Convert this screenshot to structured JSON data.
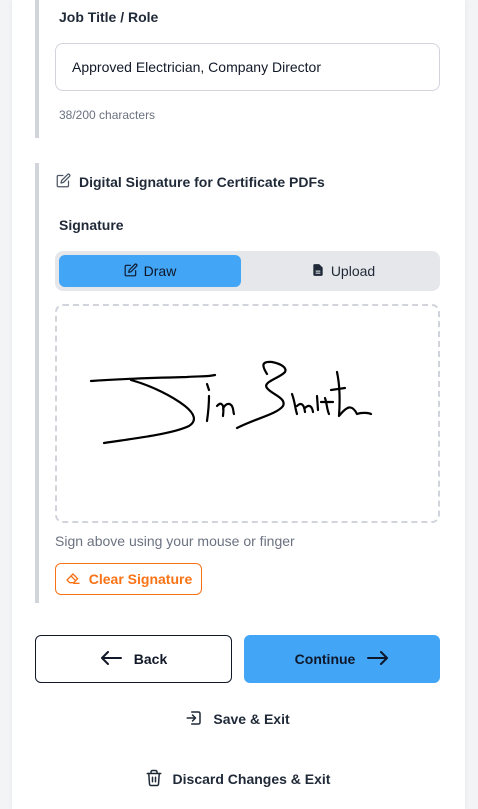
{
  "job_title": {
    "label": "Job Title / Role",
    "value": "Approved Electrician, Company Director",
    "char_count": "38/200 characters"
  },
  "signature_section": {
    "heading": "Digital Signature for Certificate PDFs",
    "label": "Signature",
    "mode_tabs": [
      {
        "label": "Draw",
        "icon": "edit-icon",
        "active": true
      },
      {
        "label": "Upload",
        "icon": "file-icon",
        "active": false
      }
    ],
    "hint": "Sign above using your mouse or finger",
    "clear_label": "Clear Signature"
  },
  "nav": {
    "back_label": "Back",
    "continue_label": "Continue",
    "save_exit_label": "Save & Exit",
    "discard_label": "Discard Changes & Exit"
  },
  "colors": {
    "accent": "#42a5f5",
    "warning": "#f97316",
    "border": "#d1d5db",
    "section_bar": "#d1d5db"
  }
}
